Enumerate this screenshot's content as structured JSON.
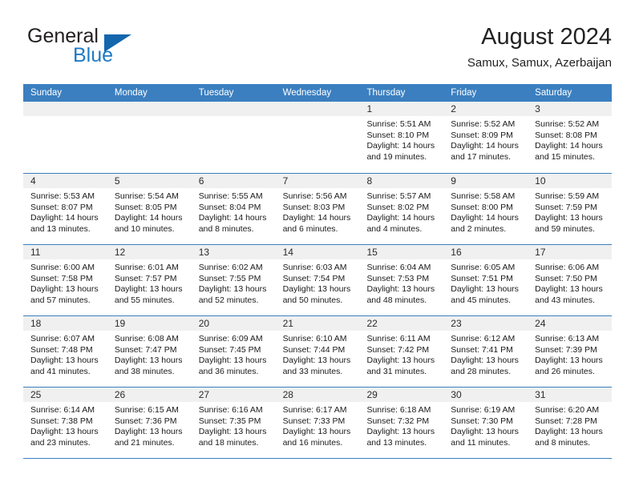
{
  "brand": {
    "word1": "General",
    "word2": "Blue",
    "triangle_color": "#1466ad",
    "blue_color": "#1f7ac4"
  },
  "header": {
    "title": "August 2024",
    "subtitle": "Samux, Samux, Azerbaijan"
  },
  "calendar": {
    "header_bg": "#3b7fc0",
    "day_band_bg": "#f0f0f0",
    "weekdays": [
      "Sunday",
      "Monday",
      "Tuesday",
      "Wednesday",
      "Thursday",
      "Friday",
      "Saturday"
    ],
    "weeks": [
      [
        {
          "day": "",
          "lines": []
        },
        {
          "day": "",
          "lines": []
        },
        {
          "day": "",
          "lines": []
        },
        {
          "day": "",
          "lines": []
        },
        {
          "day": "1",
          "lines": [
            "Sunrise: 5:51 AM",
            "Sunset: 8:10 PM",
            "Daylight: 14 hours",
            "and 19 minutes."
          ]
        },
        {
          "day": "2",
          "lines": [
            "Sunrise: 5:52 AM",
            "Sunset: 8:09 PM",
            "Daylight: 14 hours",
            "and 17 minutes."
          ]
        },
        {
          "day": "3",
          "lines": [
            "Sunrise: 5:52 AM",
            "Sunset: 8:08 PM",
            "Daylight: 14 hours",
            "and 15 minutes."
          ]
        }
      ],
      [
        {
          "day": "4",
          "lines": [
            "Sunrise: 5:53 AM",
            "Sunset: 8:07 PM",
            "Daylight: 14 hours",
            "and 13 minutes."
          ]
        },
        {
          "day": "5",
          "lines": [
            "Sunrise: 5:54 AM",
            "Sunset: 8:05 PM",
            "Daylight: 14 hours",
            "and 10 minutes."
          ]
        },
        {
          "day": "6",
          "lines": [
            "Sunrise: 5:55 AM",
            "Sunset: 8:04 PM",
            "Daylight: 14 hours",
            "and 8 minutes."
          ]
        },
        {
          "day": "7",
          "lines": [
            "Sunrise: 5:56 AM",
            "Sunset: 8:03 PM",
            "Daylight: 14 hours",
            "and 6 minutes."
          ]
        },
        {
          "day": "8",
          "lines": [
            "Sunrise: 5:57 AM",
            "Sunset: 8:02 PM",
            "Daylight: 14 hours",
            "and 4 minutes."
          ]
        },
        {
          "day": "9",
          "lines": [
            "Sunrise: 5:58 AM",
            "Sunset: 8:00 PM",
            "Daylight: 14 hours",
            "and 2 minutes."
          ]
        },
        {
          "day": "10",
          "lines": [
            "Sunrise: 5:59 AM",
            "Sunset: 7:59 PM",
            "Daylight: 13 hours",
            "and 59 minutes."
          ]
        }
      ],
      [
        {
          "day": "11",
          "lines": [
            "Sunrise: 6:00 AM",
            "Sunset: 7:58 PM",
            "Daylight: 13 hours",
            "and 57 minutes."
          ]
        },
        {
          "day": "12",
          "lines": [
            "Sunrise: 6:01 AM",
            "Sunset: 7:57 PM",
            "Daylight: 13 hours",
            "and 55 minutes."
          ]
        },
        {
          "day": "13",
          "lines": [
            "Sunrise: 6:02 AM",
            "Sunset: 7:55 PM",
            "Daylight: 13 hours",
            "and 52 minutes."
          ]
        },
        {
          "day": "14",
          "lines": [
            "Sunrise: 6:03 AM",
            "Sunset: 7:54 PM",
            "Daylight: 13 hours",
            "and 50 minutes."
          ]
        },
        {
          "day": "15",
          "lines": [
            "Sunrise: 6:04 AM",
            "Sunset: 7:53 PM",
            "Daylight: 13 hours",
            "and 48 minutes."
          ]
        },
        {
          "day": "16",
          "lines": [
            "Sunrise: 6:05 AM",
            "Sunset: 7:51 PM",
            "Daylight: 13 hours",
            "and 45 minutes."
          ]
        },
        {
          "day": "17",
          "lines": [
            "Sunrise: 6:06 AM",
            "Sunset: 7:50 PM",
            "Daylight: 13 hours",
            "and 43 minutes."
          ]
        }
      ],
      [
        {
          "day": "18",
          "lines": [
            "Sunrise: 6:07 AM",
            "Sunset: 7:48 PM",
            "Daylight: 13 hours",
            "and 41 minutes."
          ]
        },
        {
          "day": "19",
          "lines": [
            "Sunrise: 6:08 AM",
            "Sunset: 7:47 PM",
            "Daylight: 13 hours",
            "and 38 minutes."
          ]
        },
        {
          "day": "20",
          "lines": [
            "Sunrise: 6:09 AM",
            "Sunset: 7:45 PM",
            "Daylight: 13 hours",
            "and 36 minutes."
          ]
        },
        {
          "day": "21",
          "lines": [
            "Sunrise: 6:10 AM",
            "Sunset: 7:44 PM",
            "Daylight: 13 hours",
            "and 33 minutes."
          ]
        },
        {
          "day": "22",
          "lines": [
            "Sunrise: 6:11 AM",
            "Sunset: 7:42 PM",
            "Daylight: 13 hours",
            "and 31 minutes."
          ]
        },
        {
          "day": "23",
          "lines": [
            "Sunrise: 6:12 AM",
            "Sunset: 7:41 PM",
            "Daylight: 13 hours",
            "and 28 minutes."
          ]
        },
        {
          "day": "24",
          "lines": [
            "Sunrise: 6:13 AM",
            "Sunset: 7:39 PM",
            "Daylight: 13 hours",
            "and 26 minutes."
          ]
        }
      ],
      [
        {
          "day": "25",
          "lines": [
            "Sunrise: 6:14 AM",
            "Sunset: 7:38 PM",
            "Daylight: 13 hours",
            "and 23 minutes."
          ]
        },
        {
          "day": "26",
          "lines": [
            "Sunrise: 6:15 AM",
            "Sunset: 7:36 PM",
            "Daylight: 13 hours",
            "and 21 minutes."
          ]
        },
        {
          "day": "27",
          "lines": [
            "Sunrise: 6:16 AM",
            "Sunset: 7:35 PM",
            "Daylight: 13 hours",
            "and 18 minutes."
          ]
        },
        {
          "day": "28",
          "lines": [
            "Sunrise: 6:17 AM",
            "Sunset: 7:33 PM",
            "Daylight: 13 hours",
            "and 16 minutes."
          ]
        },
        {
          "day": "29",
          "lines": [
            "Sunrise: 6:18 AM",
            "Sunset: 7:32 PM",
            "Daylight: 13 hours",
            "and 13 minutes."
          ]
        },
        {
          "day": "30",
          "lines": [
            "Sunrise: 6:19 AM",
            "Sunset: 7:30 PM",
            "Daylight: 13 hours",
            "and 11 minutes."
          ]
        },
        {
          "day": "31",
          "lines": [
            "Sunrise: 6:20 AM",
            "Sunset: 7:28 PM",
            "Daylight: 13 hours",
            "and 8 minutes."
          ]
        }
      ]
    ]
  }
}
